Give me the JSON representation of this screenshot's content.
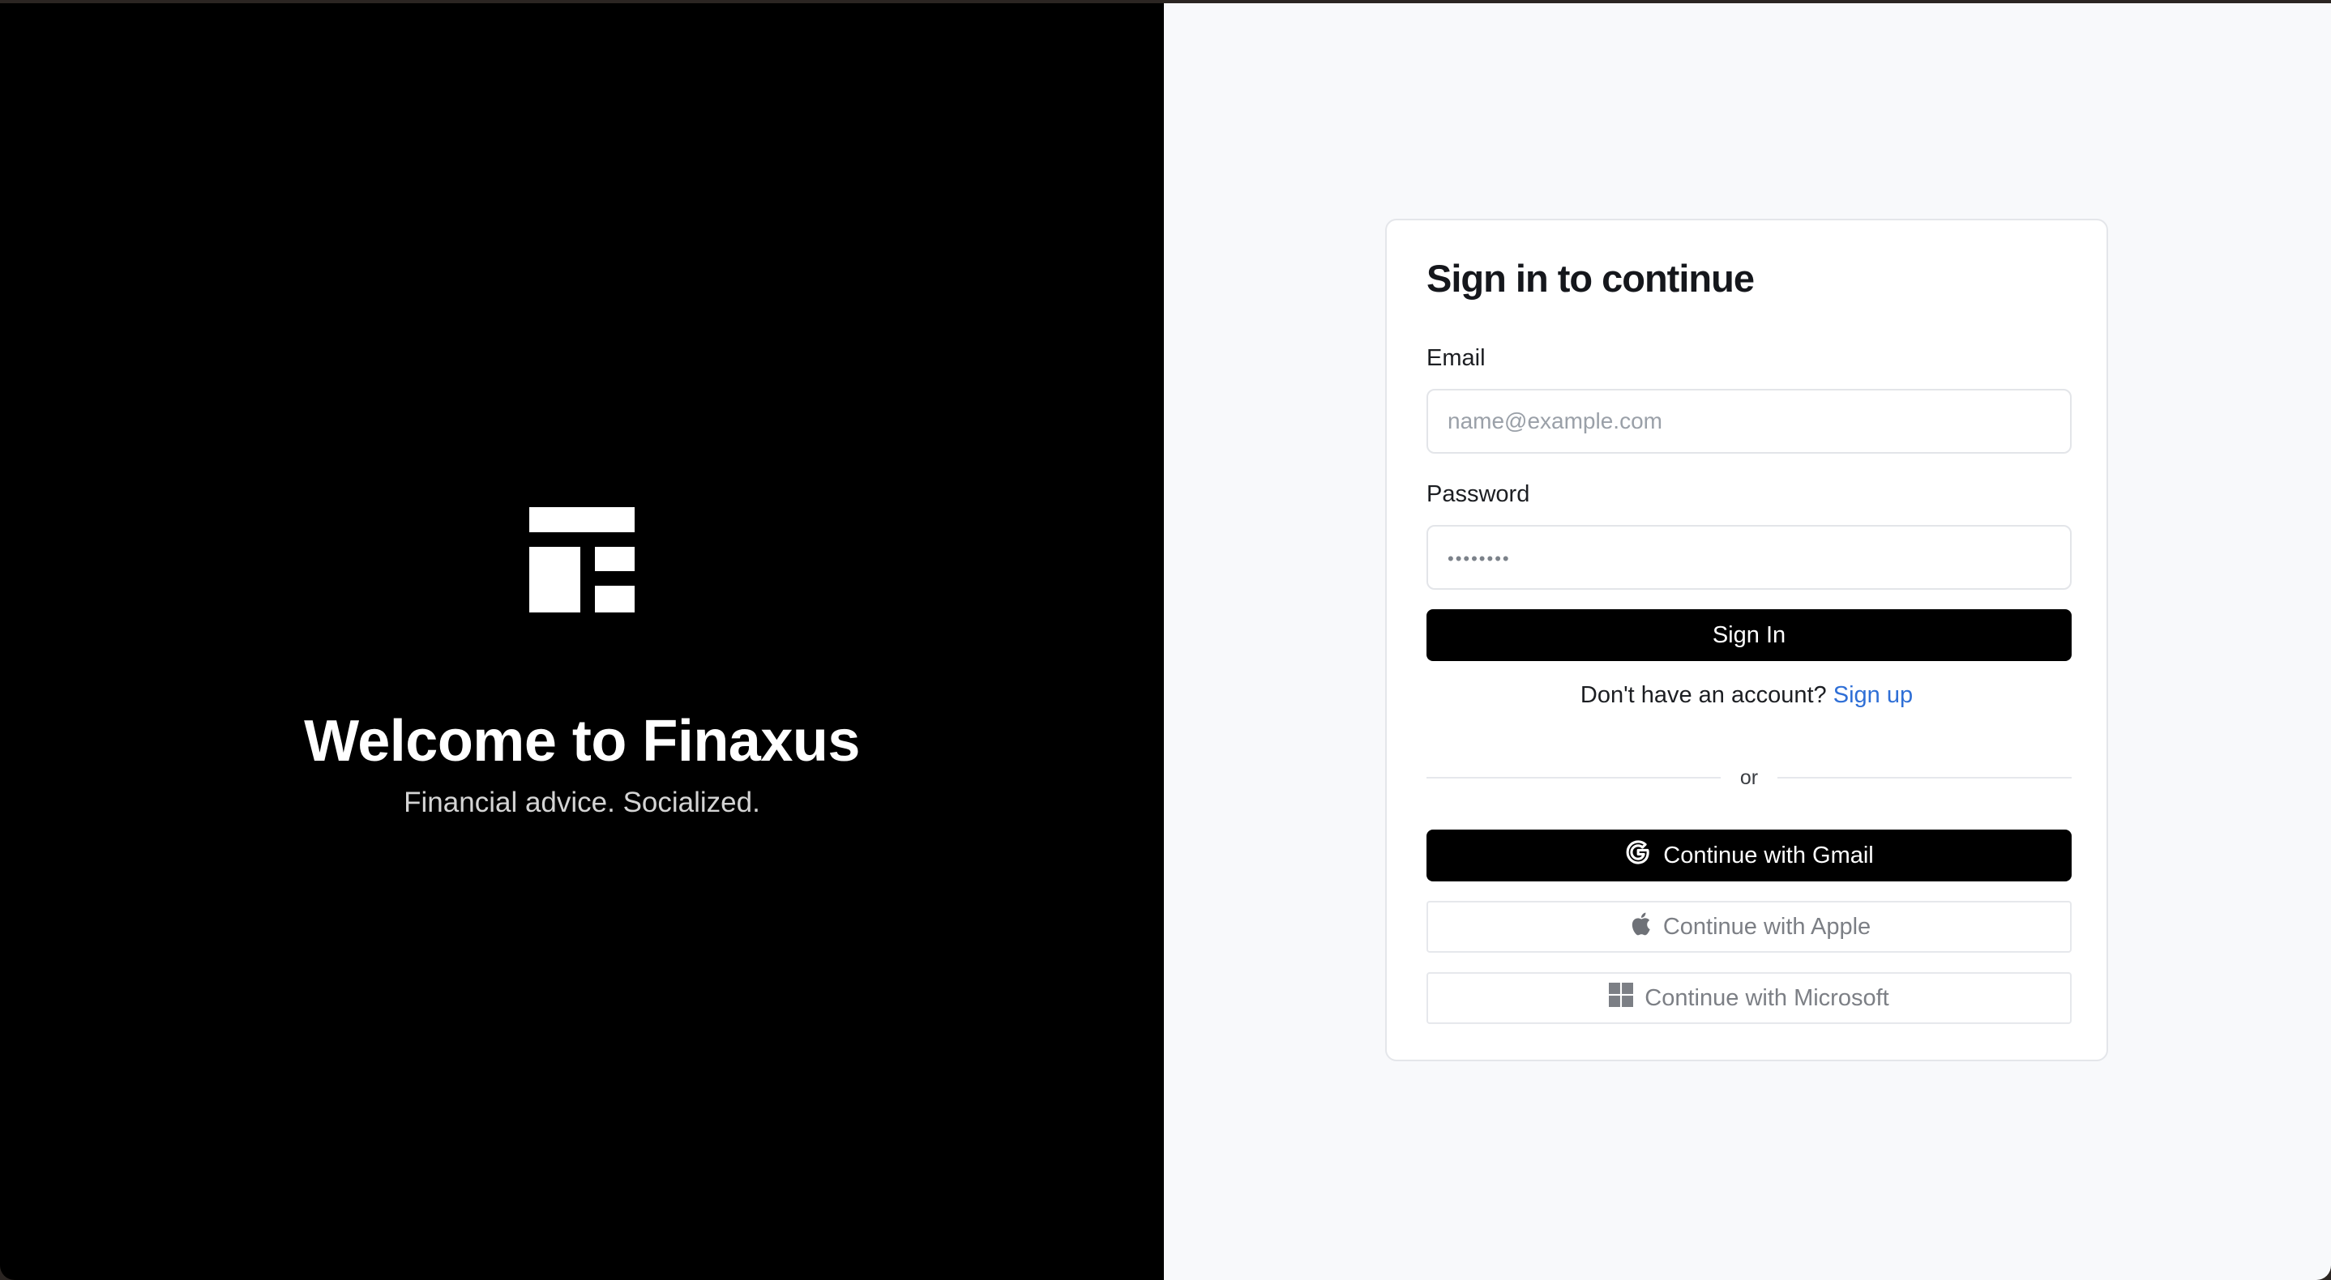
{
  "welcome": {
    "title": "Welcome to Finaxus",
    "tagline": "Financial advice. Socialized."
  },
  "signin": {
    "title": "Sign in to continue",
    "email_label": "Email",
    "email_placeholder": "name@example.com",
    "email_value": "",
    "password_label": "Password",
    "password_placeholder": "••••••••",
    "password_value": "",
    "submit_label": "Sign In",
    "no_account_text": "Don't have an account?",
    "signup_link": "Sign up",
    "divider_text": "or"
  },
  "social": [
    {
      "label": "Continue with Gmail",
      "icon": "google-icon"
    },
    {
      "label": "Continue with Apple",
      "icon": "apple-icon"
    },
    {
      "label": "Continue with Microsoft",
      "icon": "microsoft-icon"
    }
  ],
  "colors": {
    "left_background": "#000000",
    "right_background": "#f8f9fb",
    "primary_button": "#000000",
    "link": "#2f6fd6"
  }
}
